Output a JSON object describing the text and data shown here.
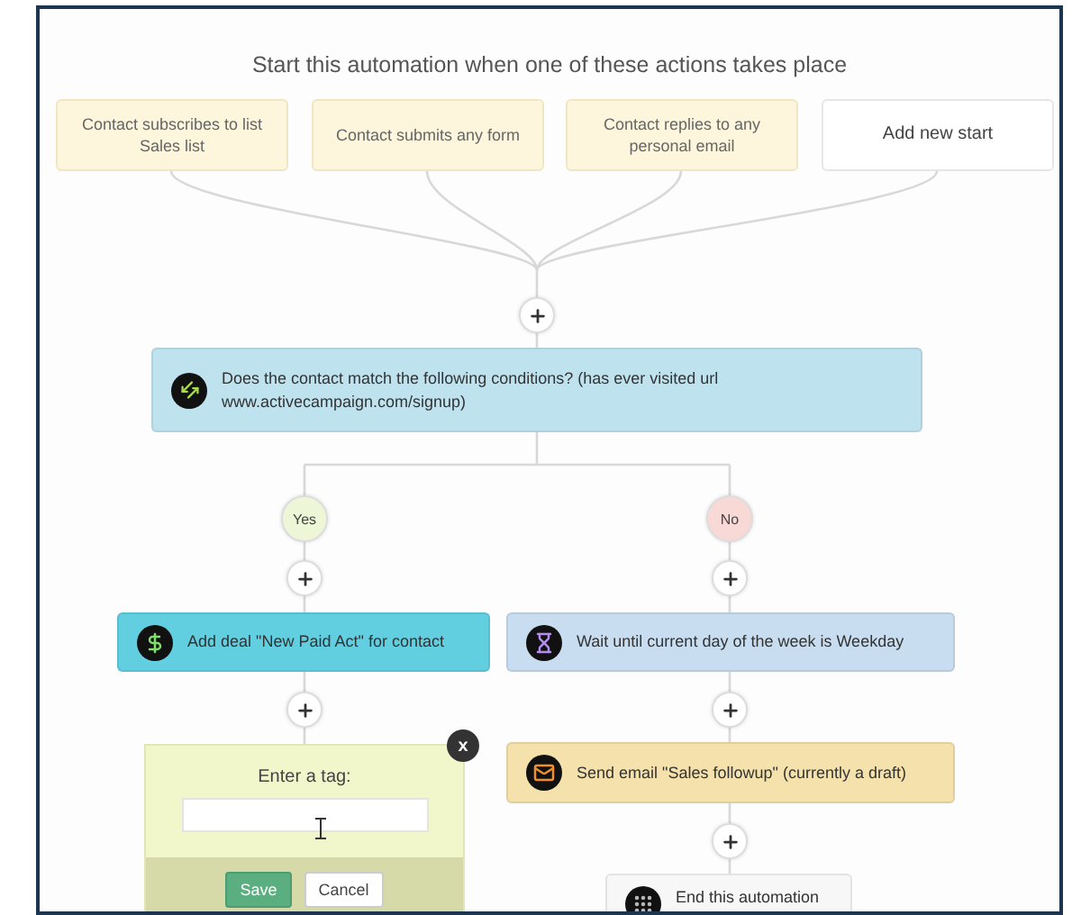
{
  "title": "Start this automation when one of these actions takes place",
  "triggers": [
    {
      "kind": "trigger",
      "label": "Contact subscribes to list Sales list"
    },
    {
      "kind": "trigger",
      "label": "Contact submits any form"
    },
    {
      "kind": "trigger",
      "label": "Contact replies to any personal email"
    },
    {
      "kind": "add",
      "label": "Add new start"
    }
  ],
  "condition": {
    "text": "Does the contact match the following conditions? (has ever visited url www.activecampaign.com/signup)"
  },
  "branches": [
    {
      "label": "Yes",
      "color": "#eef6d8",
      "actions": [
        {
          "kind": "deal",
          "text": "Add deal \"New Paid Act\" for contact",
          "color": "#62cfe0"
        }
      ]
    },
    {
      "label": "No",
      "color": "#f8d9d6",
      "actions": [
        {
          "kind": "wait",
          "text": "Wait until current day of the week is Weekday",
          "color": "#c8ddf0"
        },
        {
          "kind": "email",
          "text": "Send email \"Sales followup\" (currently a draft)",
          "color": "#f4e1ac"
        },
        {
          "kind": "end",
          "text": "End this automation",
          "color": "#f7f7f7"
        }
      ]
    }
  ],
  "tag_form": {
    "close": "x",
    "label": "Enter a tag:",
    "buttons": [
      "Save",
      "Cancel"
    ]
  }
}
